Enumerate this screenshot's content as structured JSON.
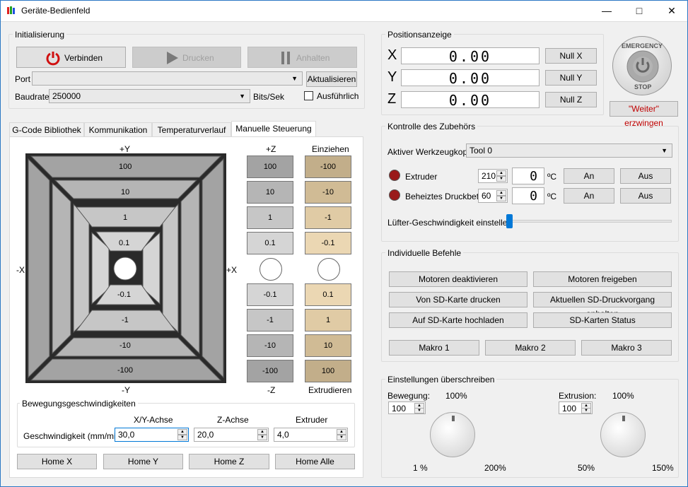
{
  "window": {
    "title": "Geräte-Bedienfeld"
  },
  "init": {
    "legend": "Initialisierung",
    "connect": "Verbinden",
    "print": "Drucken",
    "pause": "Anhalten",
    "port_label": "Port",
    "port_value": "",
    "refresh": "Aktualisieren",
    "baud_label": "Baudrate",
    "baud_value": "250000",
    "baud_unit": "Bits/Sek",
    "verbose": "Ausführlich"
  },
  "position": {
    "legend": "Positionsanzeige",
    "x_label": "X",
    "y_label": "Y",
    "z_label": "Z",
    "x_value": "0.00",
    "y_value": "0.00",
    "z_value": "0.00",
    "null_x": "Null X",
    "null_y": "Null Y",
    "null_z": "Null Z"
  },
  "emergency": {
    "top": "EMERGENCY",
    "bottom": "STOP",
    "force": "\"Weiter\" erzwingen"
  },
  "tabs": [
    "G-Code Bibliothek",
    "Kommunikation",
    "Temperaturverlauf",
    "Manuelle Steuerung"
  ],
  "jog": {
    "plus_y": "+Y",
    "minus_y": "-Y",
    "minus_x": "-X",
    "plus_x": "+X",
    "xy_up": [
      "100",
      "10",
      "1",
      "0.1"
    ],
    "xy_down": [
      "-0.1",
      "-1",
      "-10",
      "-100"
    ],
    "plus_z": "+Z",
    "minus_z": "-Z",
    "z_up": [
      "100",
      "10",
      "1",
      "0.1"
    ],
    "z_down": [
      "-0.1",
      "-1",
      "-10",
      "-100"
    ],
    "retract_label": "Einziehen",
    "extrude_label": "Extrudieren",
    "e_up": [
      "-100",
      "-10",
      "-1",
      "-0.1"
    ],
    "e_down": [
      "0.1",
      "1",
      "10",
      "100"
    ]
  },
  "speed": {
    "legend": "Bewegungsgeschwindigkeiten",
    "col_xy": "X/Y-Achse",
    "col_z": "Z-Achse",
    "col_e": "Extruder",
    "row_label": "Geschwindigkeit (mm/min)",
    "xy_value": "30,0",
    "z_value": "20,0",
    "e_value": "4,0"
  },
  "home": {
    "x": "Home X",
    "y": "Home Y",
    "z": "Home Z",
    "all": "Home Alle"
  },
  "accessory": {
    "legend": "Kontrolle des Zubehörs",
    "tool_label": "Aktiver Werkzeugkopf",
    "tool_value": "Tool 0",
    "extruder": "Extruder",
    "extruder_set": "210",
    "extruder_cur": "0",
    "bed": "Beheiztes Druckbett",
    "bed_set": "60",
    "bed_cur": "0",
    "unit": "ºC",
    "on": "An",
    "off": "Aus",
    "fan_label": "Lüfter-Geschwindigkeit einstellen"
  },
  "commands": {
    "legend": "Individuelle Befehle",
    "motors_off": "Motoren deaktivieren",
    "motors_on": "Motoren freigeben",
    "sd_print": "Von SD-Karte drucken",
    "sd_pause": "Aktuellen SD-Druckvorgang anhalten",
    "sd_upload": "Auf SD-Karte hochladen",
    "sd_status": "SD-Karten Status",
    "macro1": "Makro 1",
    "macro2": "Makro 2",
    "macro3": "Makro 3"
  },
  "override": {
    "legend": "Einstellungen überschreiben",
    "move_label": "Bewegung:",
    "move_value": "100",
    "move_pct": "100%",
    "move_min": "1 %",
    "move_max": "200%",
    "extr_label": "Extrusion:",
    "extr_value": "100",
    "extr_pct": "100%",
    "extr_min": "50%",
    "extr_max": "150%"
  }
}
